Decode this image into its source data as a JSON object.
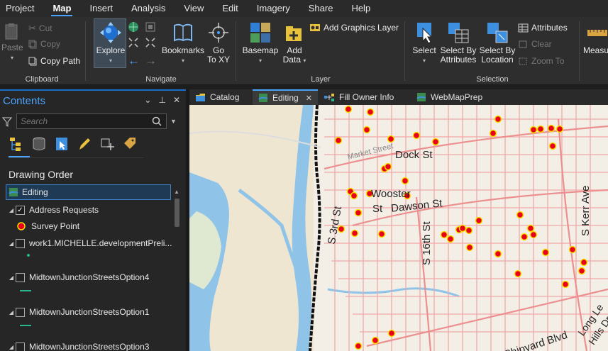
{
  "menu": {
    "tabs": [
      "Project",
      "Map",
      "Insert",
      "Analysis",
      "View",
      "Edit",
      "Imagery",
      "Share",
      "Help"
    ],
    "active": "Map"
  },
  "ribbon": {
    "clipboard": {
      "label": "Clipboard",
      "paste": "Paste",
      "cut": "Cut",
      "copy": "Copy",
      "copy_path": "Copy Path"
    },
    "navigate": {
      "label": "Navigate",
      "explore": "Explore",
      "bookmarks": "Bookmarks",
      "go_to_xy_1": "Go",
      "go_to_xy_2": "To XY"
    },
    "layer": {
      "label": "Layer",
      "basemap": "Basemap",
      "add_data_1": "Add",
      "add_data_2": "Data",
      "add_graphics_layer": "Add Graphics Layer"
    },
    "selection": {
      "label": "Selection",
      "select": "Select",
      "select_by_attributes_1": "Select By",
      "select_by_attributes_2": "Attributes",
      "select_by_location_1": "Select By",
      "select_by_location_2": "Location",
      "attributes": "Attributes",
      "clear": "Clear",
      "zoom_to": "Zoom To"
    },
    "measure": {
      "label": "Measu"
    }
  },
  "contents": {
    "title": "Contents",
    "search_placeholder": "Search",
    "drawing_order": "Drawing Order",
    "layers": [
      {
        "name": "Editing"
      },
      {
        "name": "Address Requests"
      },
      {
        "name": "Survey Point"
      },
      {
        "name": "work1.MICHELLE.developmentPreli..."
      },
      {
        "name": "MidtownJunctionStreetsOption4"
      },
      {
        "name": "MidtownJunctionStreetsOption1"
      },
      {
        "name": "MidtownJunctionStreetsOption3"
      }
    ]
  },
  "view_tabs": [
    {
      "label": "Catalog"
    },
    {
      "label": "Editing"
    },
    {
      "label": "Fill Owner Info"
    },
    {
      "label": "WebMapPrep"
    }
  ],
  "map": {
    "labels": [
      "Dock St",
      "Wooster",
      "St",
      "Dawson St",
      "S 3rd St",
      "S 16th St",
      "S Kerr Ave",
      "Shipyard Blvd",
      "Long Le",
      "Hills Dr",
      "Market Street"
    ]
  },
  "colors": {
    "accent": "#4aa3ff",
    "point_fill": "#e8001c",
    "point_outline": "#f5e100",
    "river": "#8fc3e8",
    "road": "#f0a8a8"
  }
}
